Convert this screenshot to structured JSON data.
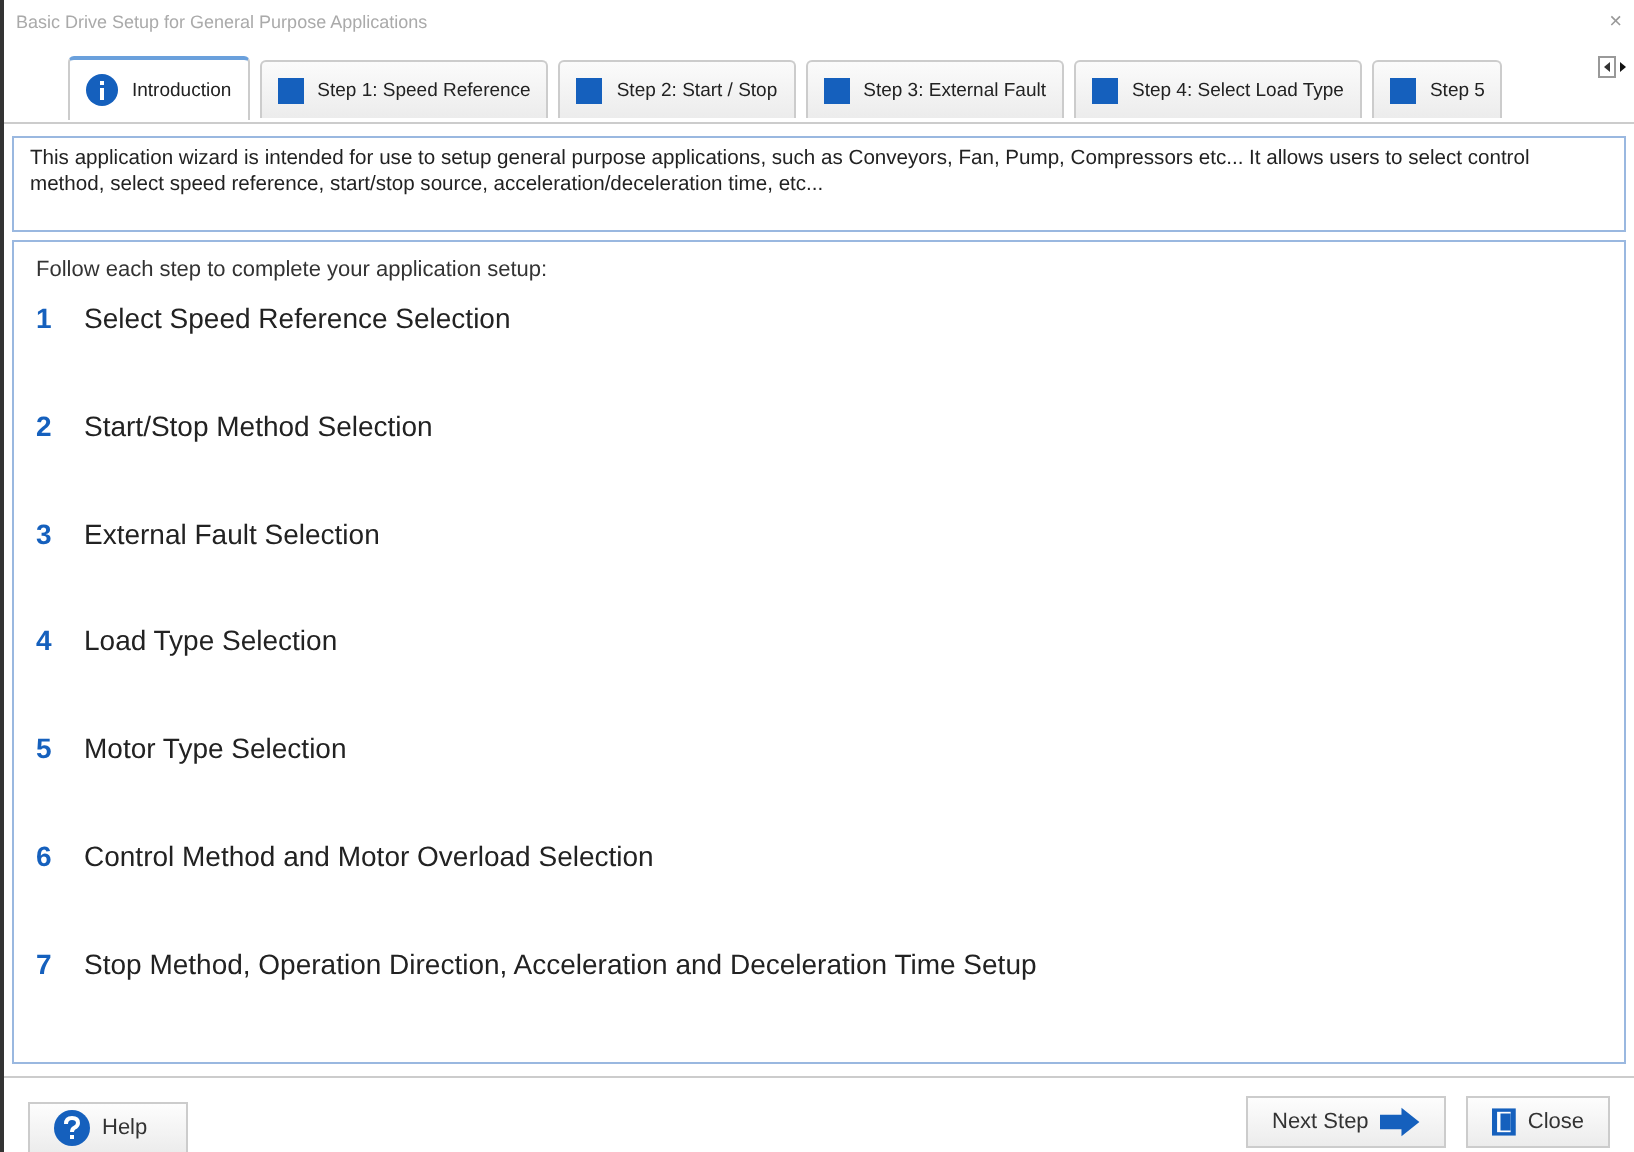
{
  "window": {
    "title": "Basic Drive Setup for General Purpose Applications",
    "close": "×"
  },
  "tabs": [
    {
      "label": "Introduction",
      "kind": "info",
      "selected": true
    },
    {
      "label": "Step 1: Speed Reference",
      "kind": "step",
      "selected": false
    },
    {
      "label": "Step 2: Start / Stop",
      "kind": "step",
      "selected": false
    },
    {
      "label": "Step 3: External Fault",
      "kind": "step",
      "selected": false
    },
    {
      "label": "Step 4: Select Load Type",
      "kind": "step",
      "selected": false
    },
    {
      "label": "Step 5",
      "kind": "step",
      "selected": false
    }
  ],
  "description": "This application wizard is intended for use to setup general purpose applications, such as Conveyors, Fan, Pump, Compressors etc... It allows users to select control method, select speed reference, start/stop source, acceleration/deceleration time, etc...",
  "steps_panel": {
    "heading": "Follow each step to complete your application setup:",
    "steps": [
      {
        "number": "1",
        "label": "Select Speed Reference Selection"
      },
      {
        "number": "2",
        "label": "Start/Stop Method Selection"
      },
      {
        "number": "3",
        "label": "External Fault Selection"
      },
      {
        "number": "4",
        "label": "Load Type Selection"
      },
      {
        "number": "5",
        "label": "Motor Type Selection"
      },
      {
        "number": "6",
        "label": "Control Method and Motor Overload Selection"
      },
      {
        "number": "7",
        "label": "Stop Method, Operation Direction, Acceleration and Deceleration Time Setup"
      }
    ]
  },
  "buttons": {
    "help": "Help",
    "next": "Next Step",
    "close": "Close"
  }
}
